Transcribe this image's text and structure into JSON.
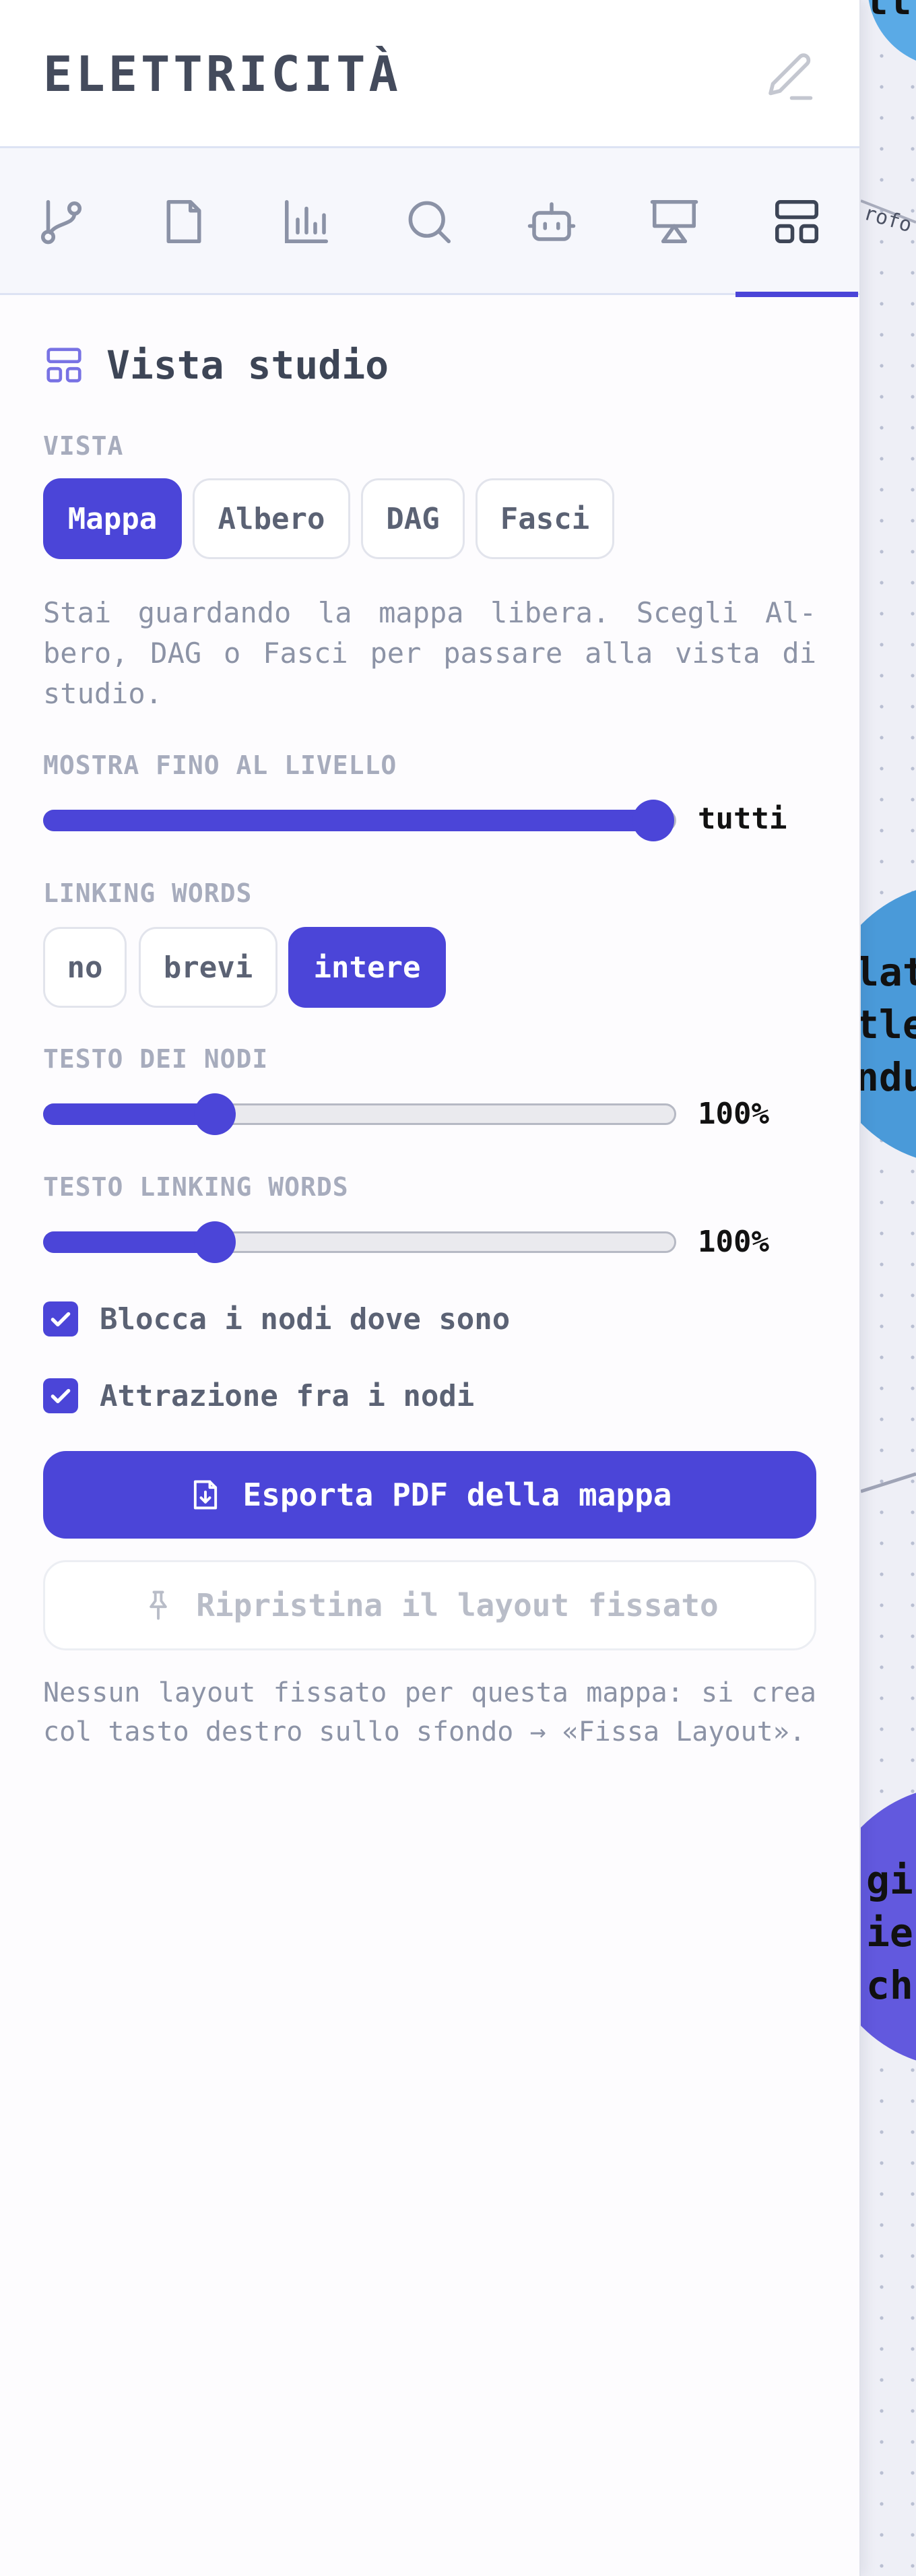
{
  "header": {
    "title": "ELETTRICITÀ",
    "edit_icon": "pencil-icon"
  },
  "tabs": [
    {
      "name": "branch-icon"
    },
    {
      "name": "file-icon"
    },
    {
      "name": "bar-chart-icon"
    },
    {
      "name": "search-icon"
    },
    {
      "name": "bot-icon"
    },
    {
      "name": "presentation-icon"
    },
    {
      "name": "layout-icon",
      "active": true
    }
  ],
  "section": {
    "title": "Vista studio",
    "icon": "layout-icon"
  },
  "view": {
    "label": "VISTA",
    "options": [
      "Mappa",
      "Albero",
      "DAG",
      "Fasci"
    ],
    "selected": "Mappa",
    "description": "Stai guardando la mappa libera. Scegli Al-bero, DAG o Fasci per passare alla vista di studio."
  },
  "level": {
    "label": "MOSTRA FINO AL LIVELLO",
    "value": "tutti",
    "fraction": 1.0
  },
  "linking": {
    "label": "LINKING WORDS",
    "options": [
      "no",
      "brevi",
      "intere"
    ],
    "selected": "intere"
  },
  "node_text": {
    "label": "TESTO DEI NODI",
    "value": "100%",
    "fraction": 0.27
  },
  "linking_text": {
    "label": "TESTO LINKING WORDS",
    "value": "100%",
    "fraction": 0.27
  },
  "checks": [
    {
      "label": "Blocca i nodi dove sono",
      "checked": true
    },
    {
      "label": "Attrazione fra i nodi",
      "checked": true
    }
  ],
  "export_button": "Esporta PDF della mappa",
  "restore_button": "Ripristina il layout fissato",
  "note": "Nessun layout fissato per questa mappa: si crea col tasto destro sullo sfondo → «Fissa Layout».",
  "map": {
    "node_texts": [
      [
        "tt"
      ],
      [
        "lat",
        "tle",
        "ndu"
      ],
      [
        "gi",
        "ie",
        "ch"
      ]
    ],
    "edge_label": "rofo",
    "colors": {
      "accent": "#4b45d8",
      "node_blue": "#4a9ad9",
      "node_top": "#5aaae6",
      "node_purple": "#6259de"
    }
  },
  "colors": {
    "accent": "#4b45d8",
    "muted": "#a7acbd"
  }
}
